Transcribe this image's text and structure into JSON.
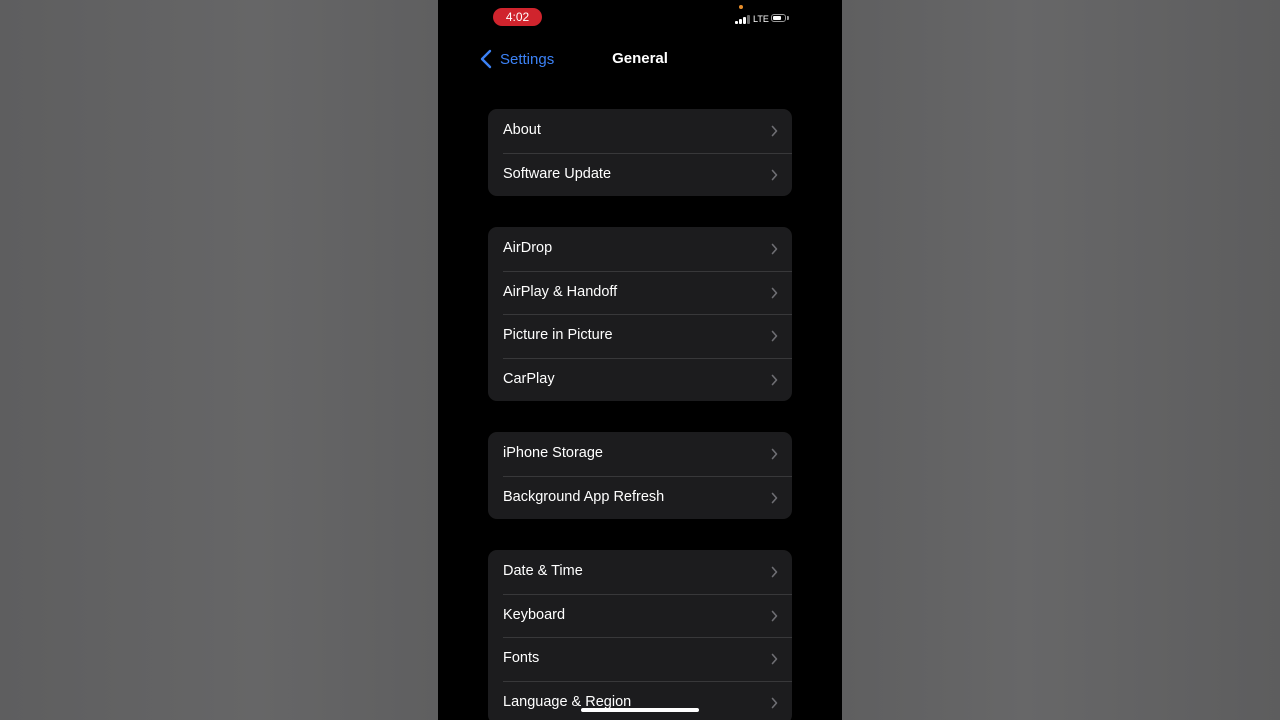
{
  "status_bar": {
    "time": "4:02",
    "network": "LTE",
    "signal_bars": 3,
    "signal_max": 4,
    "battery_level": 0.7,
    "recording_color": "#d0242d",
    "mic_indicator_color": "#e88e2a"
  },
  "nav": {
    "back_label": "Settings",
    "back_icon": "chevron-left-icon",
    "title": "General"
  },
  "groups": [
    {
      "items": [
        {
          "label": "About"
        },
        {
          "label": "Software Update"
        }
      ]
    },
    {
      "items": [
        {
          "label": "AirDrop"
        },
        {
          "label": "AirPlay & Handoff"
        },
        {
          "label": "Picture in Picture"
        },
        {
          "label": "CarPlay"
        }
      ]
    },
    {
      "items": [
        {
          "label": "iPhone Storage"
        },
        {
          "label": "Background App Refresh"
        }
      ]
    },
    {
      "items": [
        {
          "label": "Date & Time"
        },
        {
          "label": "Keyboard"
        },
        {
          "label": "Fonts"
        },
        {
          "label": "Language & Region"
        }
      ]
    }
  ],
  "row_icon": "chevron-right-icon",
  "colors": {
    "accent": "#3c82f6",
    "group_background": "#1c1c1e",
    "screen_background": "#000000"
  }
}
